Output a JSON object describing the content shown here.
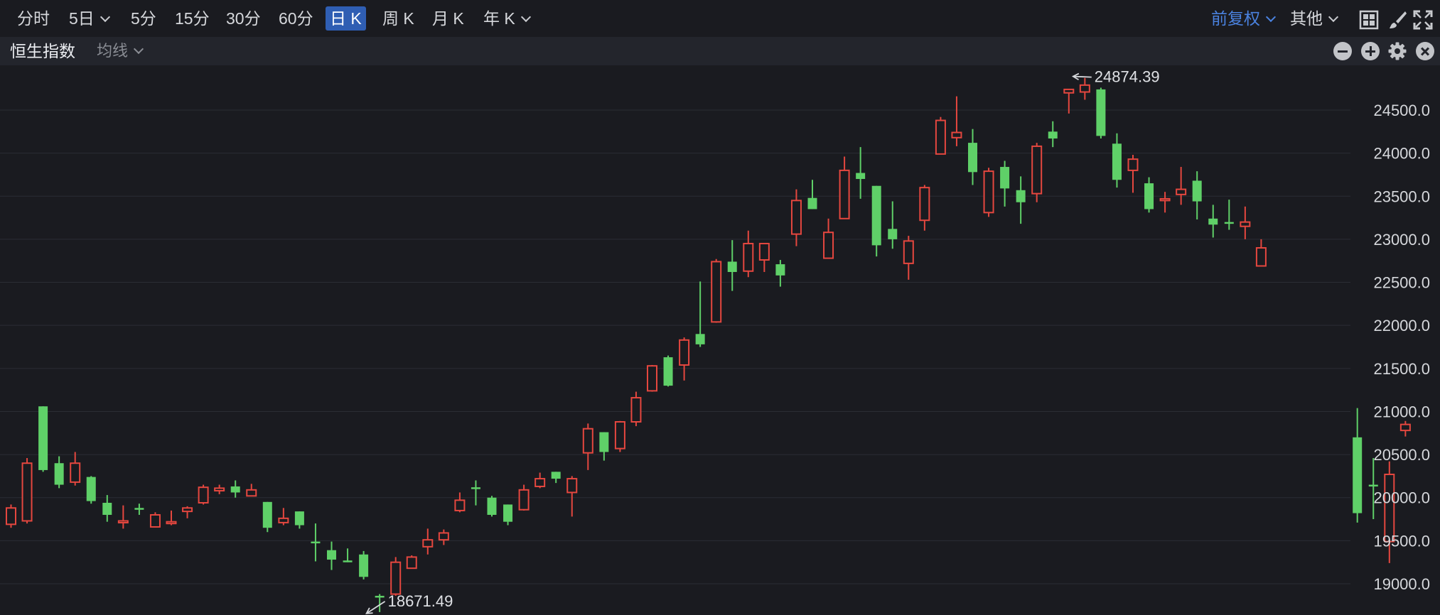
{
  "toolbar": {
    "periods": [
      {
        "label": "分时",
        "dropdown": false,
        "active": false
      },
      {
        "label": "5日",
        "dropdown": true,
        "active": false
      },
      {
        "label": "5分",
        "dropdown": false,
        "active": false
      },
      {
        "label": "15分",
        "dropdown": false,
        "active": false
      },
      {
        "label": "30分",
        "dropdown": false,
        "active": false
      },
      {
        "label": "60分",
        "dropdown": false,
        "active": false
      },
      {
        "label": "日 K",
        "dropdown": false,
        "active": true
      },
      {
        "label": "周 K",
        "dropdown": false,
        "active": false
      },
      {
        "label": "月 K",
        "dropdown": false,
        "active": false
      },
      {
        "label": "年 K",
        "dropdown": true,
        "active": false
      }
    ],
    "adjust_label": "前复权",
    "other_label": "其他",
    "icons": [
      "grid-layout-icon",
      "brush-icon",
      "fullscreen-icon"
    ]
  },
  "subbar": {
    "series_title": "恒生指数",
    "ma_label": "均线",
    "icons": [
      "zoom-out-icon",
      "zoom-in-icon",
      "settings-icon",
      "close-icon"
    ]
  },
  "colors": {
    "background": "#1a1b20",
    "subbar_background": "#23252c",
    "up": "#e5473f",
    "down": "#5fd068",
    "grid": "#2b2d34",
    "axis_text": "#d6d8dc",
    "active_tab": "#2f5eb3",
    "accent": "#4a82df"
  },
  "chart_data": {
    "type": "candlestick",
    "y_axis": {
      "position": "right",
      "ticks": [
        "24500.0",
        "24000.0",
        "23500.0",
        "23000.0",
        "22500.0",
        "22000.0",
        "21500.0",
        "21000.0",
        "20500.0",
        "20000.0",
        "19500.0",
        "19000.0"
      ],
      "range": [
        18620,
        24980
      ]
    },
    "grid": true,
    "annotations": [
      {
        "label": "24874.39",
        "value": 24874.39,
        "candle_index": 66,
        "kind": "high"
      },
      {
        "label": "18671.49",
        "value": 18671.49,
        "candle_index": 22,
        "kind": "low"
      }
    ],
    "candles": [
      {
        "o": 19690,
        "h": 19920,
        "l": 19650,
        "c": 19880,
        "dir": "up"
      },
      {
        "o": 19730,
        "h": 20460,
        "l": 19700,
        "c": 20400,
        "dir": "up"
      },
      {
        "o": 21060,
        "h": 21060,
        "l": 20300,
        "c": 20320,
        "dir": "down"
      },
      {
        "o": 20400,
        "h": 20480,
        "l": 20110,
        "c": 20150,
        "dir": "down"
      },
      {
        "o": 20180,
        "h": 20530,
        "l": 20140,
        "c": 20400,
        "dir": "up"
      },
      {
        "o": 20240,
        "h": 20250,
        "l": 19930,
        "c": 19960,
        "dir": "down"
      },
      {
        "o": 19940,
        "h": 20030,
        "l": 19720,
        "c": 19800,
        "dir": "down"
      },
      {
        "o": 19710,
        "h": 19910,
        "l": 19640,
        "c": 19730,
        "dir": "up"
      },
      {
        "o": 19880,
        "h": 19930,
        "l": 19800,
        "c": 19860,
        "dir": "down"
      },
      {
        "o": 19660,
        "h": 19830,
        "l": 19660,
        "c": 19800,
        "dir": "up"
      },
      {
        "o": 19700,
        "h": 19850,
        "l": 19680,
        "c": 19720,
        "dir": "up"
      },
      {
        "o": 19840,
        "h": 19900,
        "l": 19760,
        "c": 19880,
        "dir": "up"
      },
      {
        "o": 19940,
        "h": 20150,
        "l": 19920,
        "c": 20120,
        "dir": "up"
      },
      {
        "o": 20080,
        "h": 20150,
        "l": 20040,
        "c": 20110,
        "dir": "up"
      },
      {
        "o": 20130,
        "h": 20200,
        "l": 20000,
        "c": 20060,
        "dir": "down"
      },
      {
        "o": 20020,
        "h": 20160,
        "l": 20020,
        "c": 20090,
        "dir": "up"
      },
      {
        "o": 19950,
        "h": 19950,
        "l": 19600,
        "c": 19650,
        "dir": "down"
      },
      {
        "o": 19710,
        "h": 19880,
        "l": 19680,
        "c": 19760,
        "dir": "up"
      },
      {
        "o": 19840,
        "h": 19840,
        "l": 19640,
        "c": 19680,
        "dir": "down"
      },
      {
        "o": 19490,
        "h": 19700,
        "l": 19260,
        "c": 19470,
        "dir": "down"
      },
      {
        "o": 19390,
        "h": 19490,
        "l": 19160,
        "c": 19280,
        "dir": "down"
      },
      {
        "o": 19270,
        "h": 19410,
        "l": 19250,
        "c": 19270,
        "dir": "down"
      },
      {
        "o": 19340,
        "h": 19380,
        "l": 19050,
        "c": 19080,
        "dir": "down"
      },
      {
        "o": 18860,
        "h": 18880,
        "l": 18671,
        "c": 18840,
        "dir": "down"
      },
      {
        "o": 18880,
        "h": 19310,
        "l": 18860,
        "c": 19250,
        "dir": "up"
      },
      {
        "o": 19180,
        "h": 19330,
        "l": 19180,
        "c": 19310,
        "dir": "up"
      },
      {
        "o": 19430,
        "h": 19640,
        "l": 19340,
        "c": 19510,
        "dir": "up"
      },
      {
        "o": 19510,
        "h": 19630,
        "l": 19450,
        "c": 19590,
        "dir": "up"
      },
      {
        "o": 19850,
        "h": 20060,
        "l": 19830,
        "c": 19970,
        "dir": "up"
      },
      {
        "o": 20110,
        "h": 20200,
        "l": 19910,
        "c": 20120,
        "dir": "down"
      },
      {
        "o": 20000,
        "h": 20020,
        "l": 19780,
        "c": 19800,
        "dir": "down"
      },
      {
        "o": 19920,
        "h": 19920,
        "l": 19680,
        "c": 19720,
        "dir": "down"
      },
      {
        "o": 19860,
        "h": 20150,
        "l": 19850,
        "c": 20090,
        "dir": "up"
      },
      {
        "o": 20130,
        "h": 20290,
        "l": 20110,
        "c": 20220,
        "dir": "up"
      },
      {
        "o": 20300,
        "h": 20300,
        "l": 20170,
        "c": 20220,
        "dir": "down"
      },
      {
        "o": 20060,
        "h": 20250,
        "l": 19780,
        "c": 20220,
        "dir": "up"
      },
      {
        "o": 20520,
        "h": 20860,
        "l": 20320,
        "c": 20800,
        "dir": "up"
      },
      {
        "o": 20760,
        "h": 20760,
        "l": 20430,
        "c": 20530,
        "dir": "down"
      },
      {
        "o": 20570,
        "h": 20890,
        "l": 20530,
        "c": 20880,
        "dir": "up"
      },
      {
        "o": 20880,
        "h": 21230,
        "l": 20830,
        "c": 21160,
        "dir": "up"
      },
      {
        "o": 21240,
        "h": 21540,
        "l": 21230,
        "c": 21530,
        "dir": "up"
      },
      {
        "o": 21630,
        "h": 21650,
        "l": 21290,
        "c": 21300,
        "dir": "down"
      },
      {
        "o": 21540,
        "h": 21860,
        "l": 21360,
        "c": 21830,
        "dir": "up"
      },
      {
        "o": 21900,
        "h": 22510,
        "l": 21750,
        "c": 21780,
        "dir": "down"
      },
      {
        "o": 22040,
        "h": 22770,
        "l": 22030,
        "c": 22740,
        "dir": "up"
      },
      {
        "o": 22740,
        "h": 22990,
        "l": 22400,
        "c": 22620,
        "dir": "down"
      },
      {
        "o": 22630,
        "h": 23100,
        "l": 22560,
        "c": 22950,
        "dir": "up"
      },
      {
        "o": 22950,
        "h": 22950,
        "l": 22620,
        "c": 22760,
        "dir": "up"
      },
      {
        "o": 22710,
        "h": 22760,
        "l": 22450,
        "c": 22580,
        "dir": "down"
      },
      {
        "o": 23060,
        "h": 23580,
        "l": 22920,
        "c": 23450,
        "dir": "up"
      },
      {
        "o": 23480,
        "h": 23690,
        "l": 23350,
        "c": 23350,
        "dir": "down"
      },
      {
        "o": 22780,
        "h": 23240,
        "l": 22780,
        "c": 23080,
        "dir": "up"
      },
      {
        "o": 23240,
        "h": 23960,
        "l": 23240,
        "c": 23800,
        "dir": "up"
      },
      {
        "o": 23770,
        "h": 24070,
        "l": 23470,
        "c": 23700,
        "dir": "down"
      },
      {
        "o": 23620,
        "h": 23620,
        "l": 22800,
        "c": 22930,
        "dir": "down"
      },
      {
        "o": 23120,
        "h": 23440,
        "l": 22890,
        "c": 23000,
        "dir": "down"
      },
      {
        "o": 22720,
        "h": 23040,
        "l": 22530,
        "c": 22980,
        "dir": "up"
      },
      {
        "o": 23220,
        "h": 23630,
        "l": 23100,
        "c": 23600,
        "dir": "up"
      },
      {
        "o": 23990,
        "h": 24420,
        "l": 23990,
        "c": 24380,
        "dir": "up"
      },
      {
        "o": 24180,
        "h": 24660,
        "l": 24080,
        "c": 24240,
        "dir": "up"
      },
      {
        "o": 24120,
        "h": 24280,
        "l": 23630,
        "c": 23780,
        "dir": "down"
      },
      {
        "o": 23310,
        "h": 23830,
        "l": 23260,
        "c": 23790,
        "dir": "up"
      },
      {
        "o": 23840,
        "h": 23910,
        "l": 23380,
        "c": 23590,
        "dir": "down"
      },
      {
        "o": 23570,
        "h": 23730,
        "l": 23180,
        "c": 23430,
        "dir": "down"
      },
      {
        "o": 23530,
        "h": 24120,
        "l": 23430,
        "c": 24080,
        "dir": "up"
      },
      {
        "o": 24250,
        "h": 24370,
        "l": 24070,
        "c": 24170,
        "dir": "down"
      },
      {
        "o": 24700,
        "h": 24730,
        "l": 24460,
        "c": 24740,
        "dir": "up"
      },
      {
        "o": 24710,
        "h": 24874,
        "l": 24620,
        "c": 24790,
        "dir": "up"
      },
      {
        "o": 24740,
        "h": 24760,
        "l": 24170,
        "c": 24200,
        "dir": "down"
      },
      {
        "o": 24110,
        "h": 24230,
        "l": 23600,
        "c": 23690,
        "dir": "down"
      },
      {
        "o": 23800,
        "h": 23980,
        "l": 23540,
        "c": 23930,
        "dir": "up"
      },
      {
        "o": 23650,
        "h": 23720,
        "l": 23310,
        "c": 23350,
        "dir": "down"
      },
      {
        "o": 23460,
        "h": 23550,
        "l": 23310,
        "c": 23470,
        "dir": "up"
      },
      {
        "o": 23520,
        "h": 23840,
        "l": 23400,
        "c": 23580,
        "dir": "up"
      },
      {
        "o": 23680,
        "h": 23790,
        "l": 23230,
        "c": 23440,
        "dir": "down"
      },
      {
        "o": 23240,
        "h": 23400,
        "l": 23020,
        "c": 23170,
        "dir": "down"
      },
      {
        "o": 23200,
        "h": 23460,
        "l": 23110,
        "c": 23200,
        "dir": "down"
      },
      {
        "o": 23150,
        "h": 23380,
        "l": 23000,
        "c": 23200,
        "dir": "up"
      },
      {
        "o": 22690,
        "h": 23000,
        "l": 22690,
        "c": 22900,
        "dir": "up"
      },
      {
        "o": 20700,
        "h": 21040,
        "l": 19710,
        "c": 19820,
        "dir": "down"
      },
      {
        "o": 20150,
        "h": 20460,
        "l": 19750,
        "c": 20130,
        "dir": "down"
      },
      {
        "o": 19490,
        "h": 20420,
        "l": 19240,
        "c": 20270,
        "dir": "up"
      },
      {
        "o": 20780,
        "h": 20890,
        "l": 20710,
        "c": 20850,
        "dir": "up"
      }
    ],
    "gaps_after_index": [
      78
    ]
  }
}
